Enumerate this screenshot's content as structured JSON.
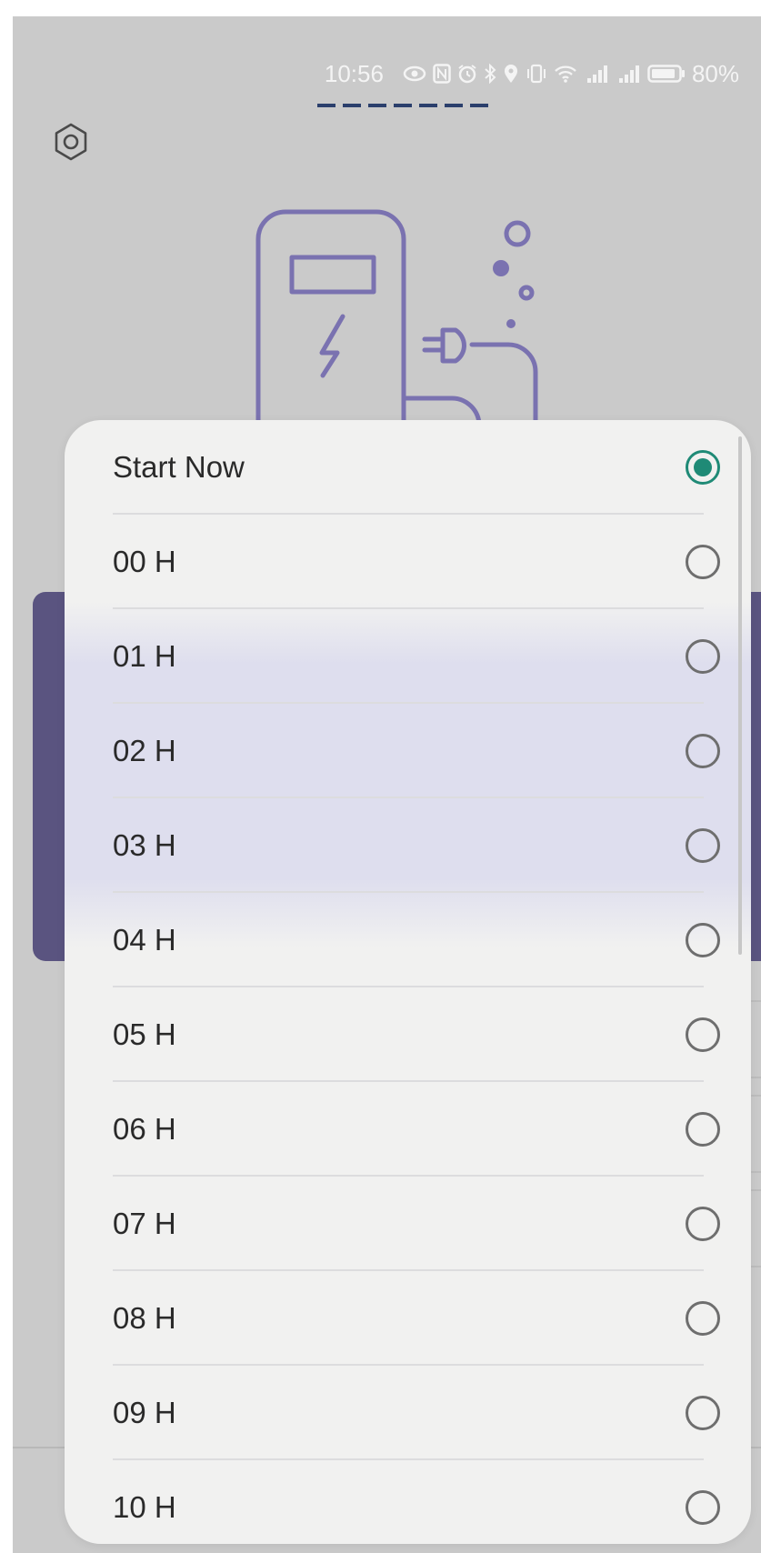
{
  "status_bar": {
    "time": "10:56",
    "battery": "80%",
    "icons": [
      "eye-icon",
      "nfc-icon",
      "alarm-icon",
      "bluetooth-icon",
      "location-icon",
      "vibrate-icon",
      "wifi-icon",
      "signal-icon",
      "signal-icon",
      "battery-icon"
    ]
  },
  "header": {
    "settings_icon": "gear-icon"
  },
  "illustration": {
    "icon": "ev-charger-icon"
  },
  "sheet": {
    "options": [
      {
        "label": "Start Now",
        "selected": true
      },
      {
        "label": "00 H",
        "selected": false
      },
      {
        "label": "01 H",
        "selected": false
      },
      {
        "label": "02 H",
        "selected": false
      },
      {
        "label": "03 H",
        "selected": false
      },
      {
        "label": "04 H",
        "selected": false
      },
      {
        "label": "05 H",
        "selected": false
      },
      {
        "label": "06 H",
        "selected": false
      },
      {
        "label": "07 H",
        "selected": false
      },
      {
        "label": "08 H",
        "selected": false
      },
      {
        "label": "09 H",
        "selected": false
      },
      {
        "label": "10 H",
        "selected": false
      }
    ]
  },
  "colors": {
    "accent": "#1f8a76",
    "brand": "#5a5480"
  }
}
